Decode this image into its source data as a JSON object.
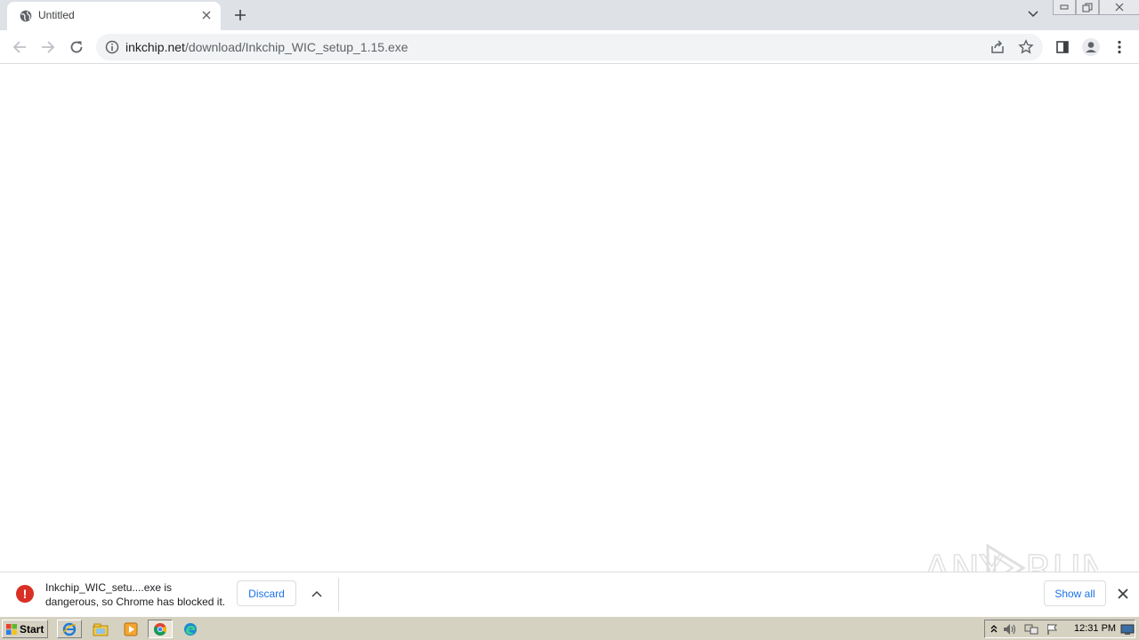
{
  "tab": {
    "title": "Untitled",
    "favicon": "globe-icon"
  },
  "omnibox": {
    "host": "inkchip.net",
    "path": "/download/Inkchip_WIC_setup_1.15.exe"
  },
  "download": {
    "line1": "Inkchip_WIC_setu....exe is",
    "line2": "dangerous, so Chrome has blocked it.",
    "discard_label": "Discard",
    "show_all_label": "Show all",
    "status_color": "#d93025"
  },
  "taskbar": {
    "start_label": "Start",
    "clock": "12:31 PM"
  },
  "watermark": {
    "text": "ANY RUN"
  }
}
